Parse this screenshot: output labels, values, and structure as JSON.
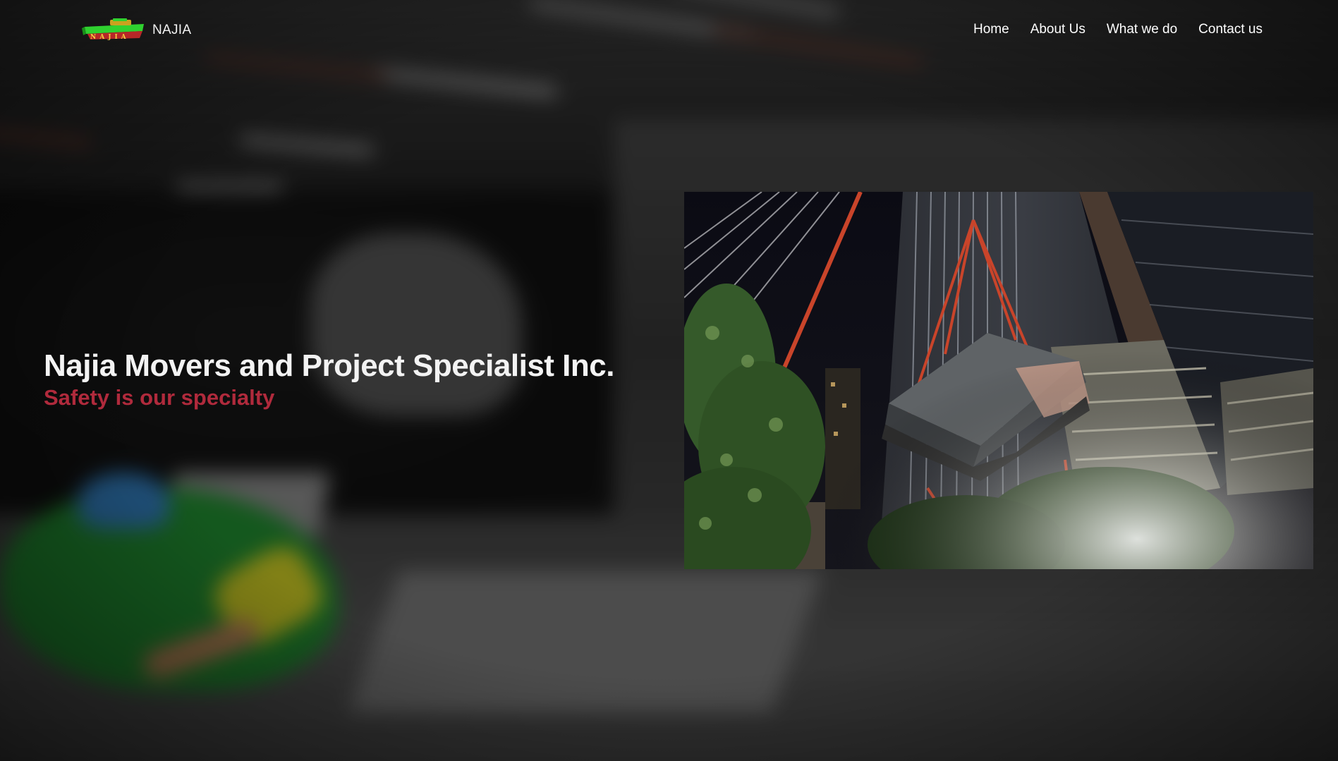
{
  "header": {
    "brand_name": "NAJIA",
    "logo_icon": "najia-logo-icon",
    "nav": [
      {
        "label": "Home"
      },
      {
        "label": "About Us"
      },
      {
        "label": "What we do"
      },
      {
        "label": "Contact us"
      }
    ]
  },
  "hero": {
    "title": "Najia Movers and Project Specialist Inc.",
    "tagline": "Safety is our specialty",
    "photo_icon": "crane-lift-photo"
  },
  "colors": {
    "tagline": "#b02a3c",
    "text": "#f3f3f3",
    "logo_green": "#2fd12f",
    "logo_red": "#d42a2a"
  }
}
